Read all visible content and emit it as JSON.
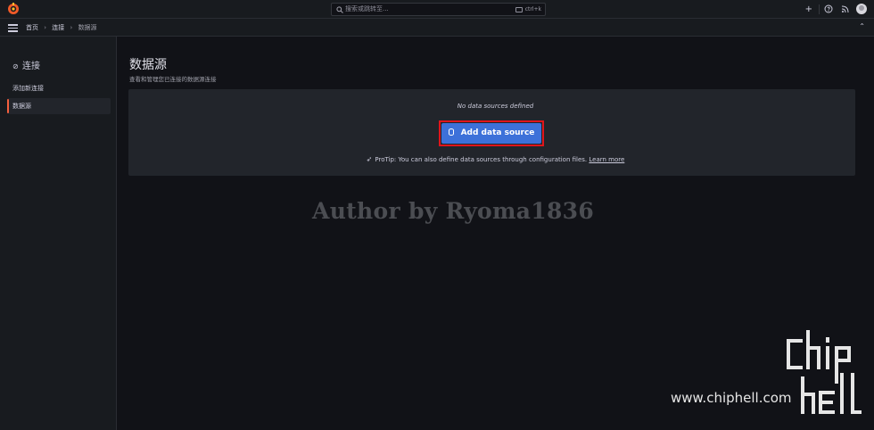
{
  "topbar": {
    "search_placeholder": "搜索或跳转至...",
    "search_shortcut": "ctrl+k",
    "new_label": "+",
    "new_caret": "▾"
  },
  "breadcrumb": {
    "items": [
      "首页",
      "连接",
      "数据源"
    ],
    "separator": "›"
  },
  "sidenav": {
    "title": "连接",
    "items": [
      {
        "label": "添加新连接",
        "active": false
      },
      {
        "label": "数据源",
        "active": true
      }
    ]
  },
  "page": {
    "title": "数据源",
    "subtitle": "查看和管理您已连接的数据源连接"
  },
  "empty_state": {
    "message": "No data sources defined",
    "button_label": "Add data source",
    "protip_text": "ProTip: You can also define data sources through configuration files.",
    "protip_link": "Learn more"
  },
  "watermark": {
    "author": "Author by Ryoma1836",
    "site_url": "www.chiphell.com"
  },
  "colors": {
    "primary_button": "#3d71d9",
    "highlight_frame": "#e0151b",
    "active_accent": "#f55f3e",
    "logo_orange": "#f05a28"
  }
}
